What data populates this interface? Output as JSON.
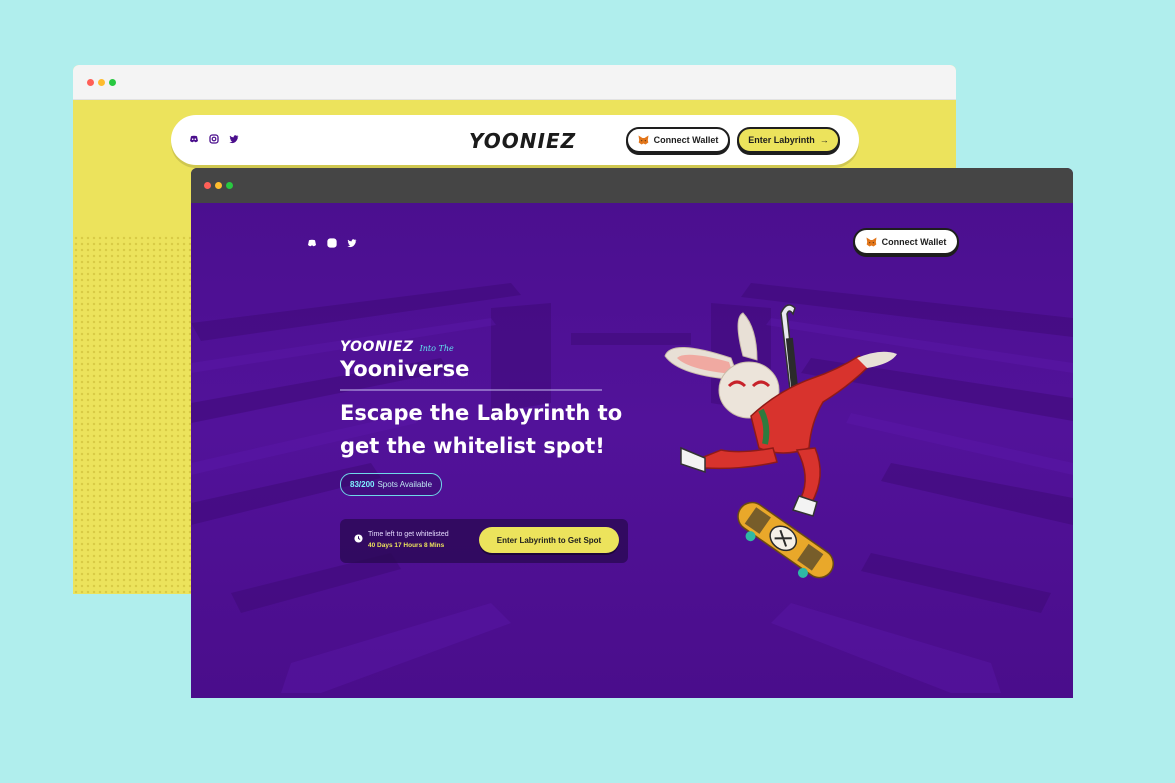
{
  "back_window": {
    "socials": [
      "discord-icon",
      "instagram-icon",
      "twitter-icon"
    ],
    "logo": "YOONIEZ",
    "connect_wallet": "Connect Wallet",
    "enter_labyrinth": "Enter Labyrinth",
    "enter_arrow": "→"
  },
  "front_window": {
    "socials": [
      "discord-icon",
      "instagram-icon",
      "twitter-icon"
    ],
    "connect_wallet": "Connect Wallet",
    "brand_logo": "YOONIEZ",
    "brand_into": "Into The",
    "brand_title": "Yooniverse",
    "headline": "Escape the Labyrinth to get the whitelist spot!",
    "spots_count": "83/200",
    "spots_label": "Spots Available",
    "timer_label": "Time left to get whitelisted",
    "timer_value": "40 Days 17 Hours 8 Mins",
    "cta": "Enter Labyrinth to Get Spot"
  },
  "colors": {
    "background": "#b0eeed",
    "yellow": "#ece35c",
    "purple": "#4a0e8c",
    "cyan_accent": "#63e3f0"
  }
}
